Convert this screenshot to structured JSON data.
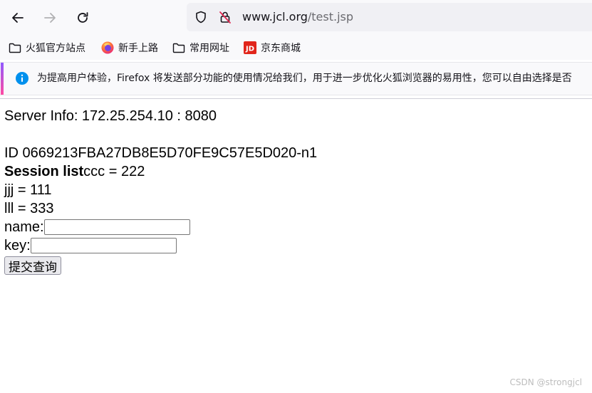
{
  "url": {
    "host": "www.jcl.org",
    "path": "/test.jsp"
  },
  "bookmarks": [
    {
      "label": "火狐官方站点",
      "icon": "folder-icon"
    },
    {
      "label": "新手上路",
      "icon": "firefox-logo-icon"
    },
    {
      "label": "常用网址",
      "icon": "folder-icon"
    },
    {
      "label": "京东商城",
      "icon": "jd-logo-icon"
    }
  ],
  "notice": {
    "text": "为提高用户体验，Firefox 将发送部分功能的使用情况给我们，用于进一步优化火狐浏览器的易用性，您可以自由选择是否"
  },
  "page": {
    "server_info": "Server Info: 172.25.254.10 : 8080",
    "session_id": "ID 0669213FBA27DB8E5D70FE9C57E5D020-n1",
    "session_list_label": "Session list",
    "session_items": [
      "ccc = 222",
      "jjj = 111",
      "lll = 333"
    ],
    "name_label": "name:",
    "name_value": "",
    "key_label": "key:",
    "key_value": "",
    "submit_label": "提交查询"
  },
  "watermark": "CSDN @strongjcl",
  "colors": {
    "accent_info": "#0090ed",
    "notice_gradient_top": "#9059ff",
    "notice_gradient_bottom": "#ff4aa2"
  }
}
